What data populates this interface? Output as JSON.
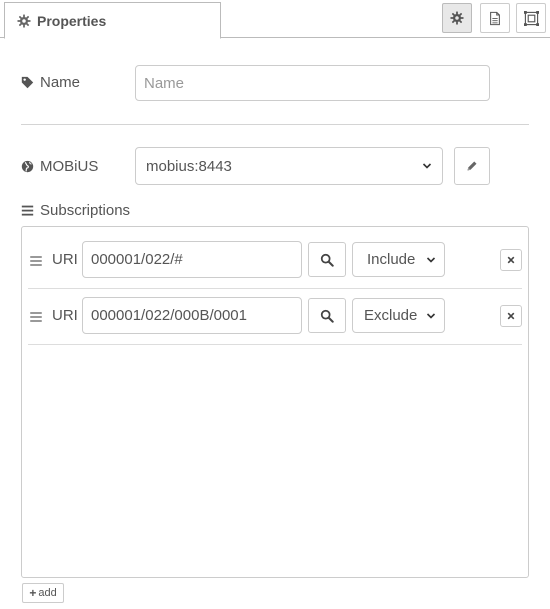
{
  "header": {
    "tab_title": "Properties",
    "tab_icon": "gear-icon",
    "toolbar": [
      {
        "icon": "gear-icon",
        "active": true
      },
      {
        "icon": "document-icon",
        "active": false
      },
      {
        "icon": "frame-icon",
        "active": false
      }
    ]
  },
  "form": {
    "name": {
      "label": "Name",
      "icon": "tag-icon",
      "value": "",
      "placeholder": "Name"
    },
    "mobius": {
      "label": "MOBiUS",
      "icon": "globe-icon",
      "selected": "mobius:8443",
      "edit_icon": "pencil-icon"
    },
    "subscriptions": {
      "label": "Subscriptions",
      "icon": "list-icon",
      "items": [
        {
          "uri_label": "URI",
          "uri": "000001/022/#",
          "mode": "Include"
        },
        {
          "uri_label": "URI",
          "uri": "000001/022/000B/0001",
          "mode": "Exclude"
        }
      ],
      "add_label": "add"
    }
  },
  "colors": {
    "border": "#cccccc",
    "text": "#555555",
    "placeholder": "#999999",
    "active_button": "#e8e8e8"
  }
}
